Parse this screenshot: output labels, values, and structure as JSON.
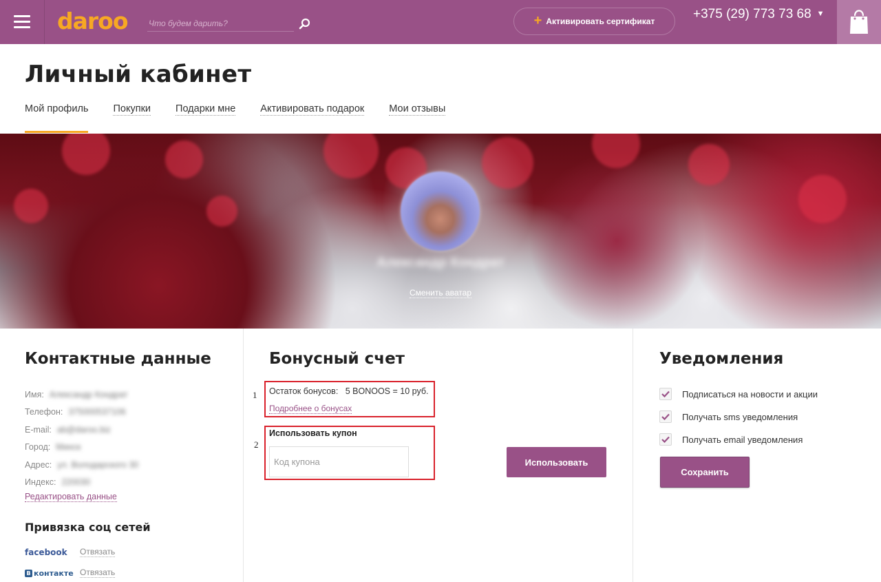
{
  "header": {
    "logo": "daroo",
    "search_placeholder": "Что будем дарить?",
    "certificate_button": "Активировать сертификат",
    "phone": "+375 (29) 773 73 68",
    "accent_color": "#995187",
    "logo_color": "#f7a823"
  },
  "page": {
    "title": "Личный кабинет",
    "tabs": [
      {
        "label": "Мой профиль",
        "active": true
      },
      {
        "label": "Покупки",
        "active": false
      },
      {
        "label": "Подарки мне",
        "active": false
      },
      {
        "label": "Активировать подарок",
        "active": false
      },
      {
        "label": "Мои отзывы",
        "active": false
      }
    ]
  },
  "banner": {
    "user_name": "Александр Кондрат",
    "change_avatar": "Сменить аватар"
  },
  "contacts": {
    "title": "Контактные данные",
    "rows": [
      {
        "label": "Имя:",
        "value": "Александр Кондрат"
      },
      {
        "label": "Телефон:",
        "value": "375000537106"
      },
      {
        "label": "E-mail:",
        "value": "ab@daroo.biz"
      },
      {
        "label": "Город:",
        "value": "Минск"
      },
      {
        "label": "Адрес:",
        "value": "ул. Володарского 30"
      },
      {
        "label": "Индекс:",
        "value": "220030"
      }
    ],
    "edit_link": "Редактировать данные",
    "social_title": "Привязка соц сетей",
    "social": [
      {
        "network": "facebook",
        "action": "Отвязать"
      },
      {
        "network": "контакте",
        "action": "Отвязать"
      }
    ]
  },
  "bonus": {
    "title": "Бонусный счет",
    "marker_1": "1",
    "marker_2": "2",
    "balance_label": "Остаток бонусов:",
    "balance_value": "5 BONOOS = 10 руб.",
    "details_link": "Подробнее о бонусах",
    "coupon_title": "Использовать купон",
    "coupon_placeholder": "Код купона",
    "use_button": "Использовать"
  },
  "notifications": {
    "title": "Уведомления",
    "items": [
      {
        "label": "Подписаться на новости и акции",
        "checked": true
      },
      {
        "label": "Получать sms уведомления",
        "checked": true
      },
      {
        "label": "Получать email уведомления",
        "checked": true
      }
    ],
    "save_button": "Сохранить"
  }
}
